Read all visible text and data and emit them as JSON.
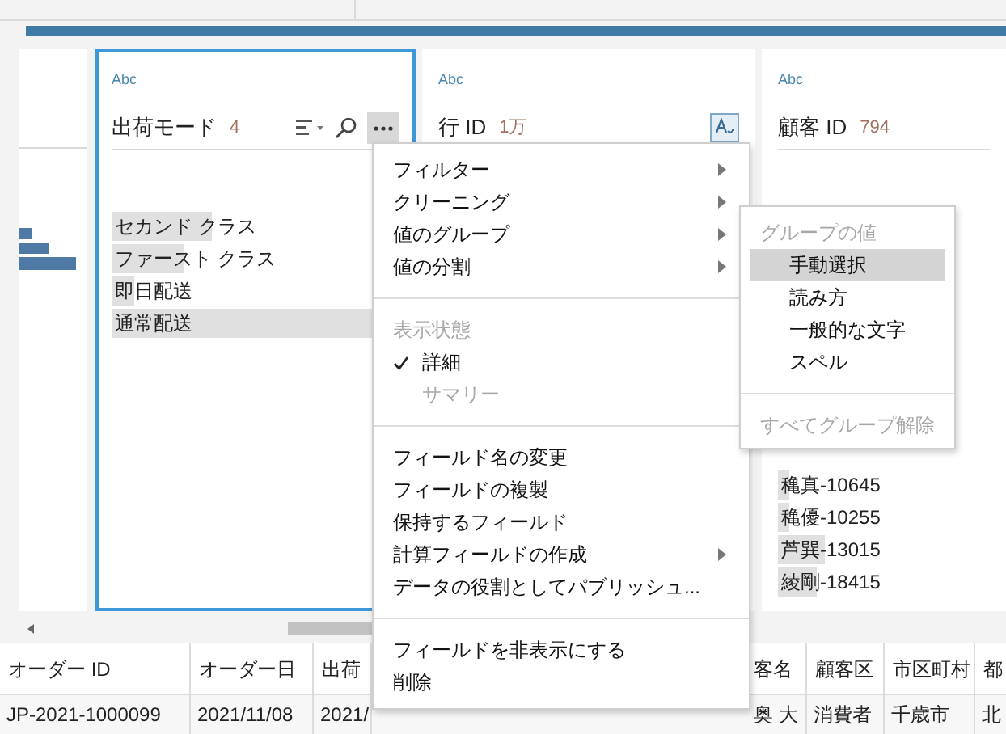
{
  "cards": [
    {
      "type_label": "Abc",
      "title": "出荷モード",
      "count": "4",
      "selected": true,
      "menu_open": true,
      "values": [
        {
          "label": "セカンド クラス",
          "level": 0.35
        },
        {
          "label": "ファースト クラス",
          "level": 0.25
        },
        {
          "label": "即日配送",
          "level": 0.08
        },
        {
          "label": "通常配送",
          "level": 1.0
        }
      ]
    },
    {
      "type_label": "Abc",
      "title": "行 ID",
      "count": "1万",
      "selected": false
    },
    {
      "type_label": "Abc",
      "title": "顧客 ID",
      "count": "794",
      "selected": false,
      "values": [
        {
          "label": "穐真-10645",
          "level": 0.06
        },
        {
          "label": "穐優-10255",
          "level": 0.06
        },
        {
          "label": "芦巽-13015",
          "level": 0.24
        },
        {
          "label": "綾剛-18415",
          "level": 0.2
        }
      ]
    }
  ],
  "menu": {
    "sections": [
      {
        "items": [
          {
            "kind": "item",
            "label": "フィルター",
            "submenu": true,
            "checked": false,
            "disabled": false
          },
          {
            "kind": "item",
            "label": "クリーニング",
            "submenu": true,
            "checked": false,
            "disabled": false
          },
          {
            "kind": "item",
            "label": "値のグループ",
            "submenu": true,
            "checked": false,
            "disabled": false
          },
          {
            "kind": "item",
            "label": "値の分割",
            "submenu": true,
            "checked": false,
            "disabled": false
          }
        ]
      },
      {
        "items": [
          {
            "kind": "header",
            "label": "表示状態"
          },
          {
            "kind": "item",
            "label": "詳細",
            "submenu": false,
            "checked": true,
            "disabled": false
          },
          {
            "kind": "item",
            "label": "サマリー",
            "submenu": false,
            "checked": false,
            "disabled": true
          }
        ]
      },
      {
        "items": [
          {
            "kind": "item",
            "label": "フィールド名の変更",
            "submenu": false,
            "checked": false,
            "disabled": false
          },
          {
            "kind": "item",
            "label": "フィールドの複製",
            "submenu": false,
            "checked": false,
            "disabled": false
          },
          {
            "kind": "item",
            "label": "保持するフィールド",
            "submenu": false,
            "checked": false,
            "disabled": false
          },
          {
            "kind": "item",
            "label": "計算フィールドの作成",
            "submenu": true,
            "checked": false,
            "disabled": false
          },
          {
            "kind": "item",
            "label": "データの役割としてパブリッシュ...",
            "submenu": false,
            "checked": false,
            "disabled": false
          }
        ]
      },
      {
        "items": [
          {
            "kind": "item",
            "label": "フィールドを非表示にする",
            "submenu": false,
            "checked": false,
            "disabled": false
          },
          {
            "kind": "item",
            "label": "削除",
            "submenu": false,
            "checked": false,
            "disabled": false
          }
        ]
      }
    ]
  },
  "submenu": {
    "sections": [
      {
        "items": [
          {
            "kind": "header",
            "label": "グループの値"
          },
          {
            "kind": "item",
            "label": "手動選択",
            "selected": true,
            "disabled": false
          },
          {
            "kind": "item",
            "label": "読み方",
            "selected": false,
            "disabled": false
          },
          {
            "kind": "item",
            "label": "一般的な文字",
            "selected": false,
            "disabled": false
          },
          {
            "kind": "item",
            "label": "スペル",
            "selected": false,
            "disabled": false
          }
        ]
      },
      {
        "items": [
          {
            "kind": "item",
            "label": "すべてグループ解除",
            "selected": false,
            "disabled": true
          }
        ]
      }
    ]
  },
  "table": {
    "columns": [
      "オーダー ID",
      "オーダー日",
      "出荷",
      "客名",
      "顧客区",
      "市区町村",
      "都"
    ],
    "rows": [
      [
        "JP-2021-1000099",
        "2021/11/08",
        "2021/",
        "奥 大",
        "消費者",
        "千歳市",
        "北"
      ]
    ]
  }
}
